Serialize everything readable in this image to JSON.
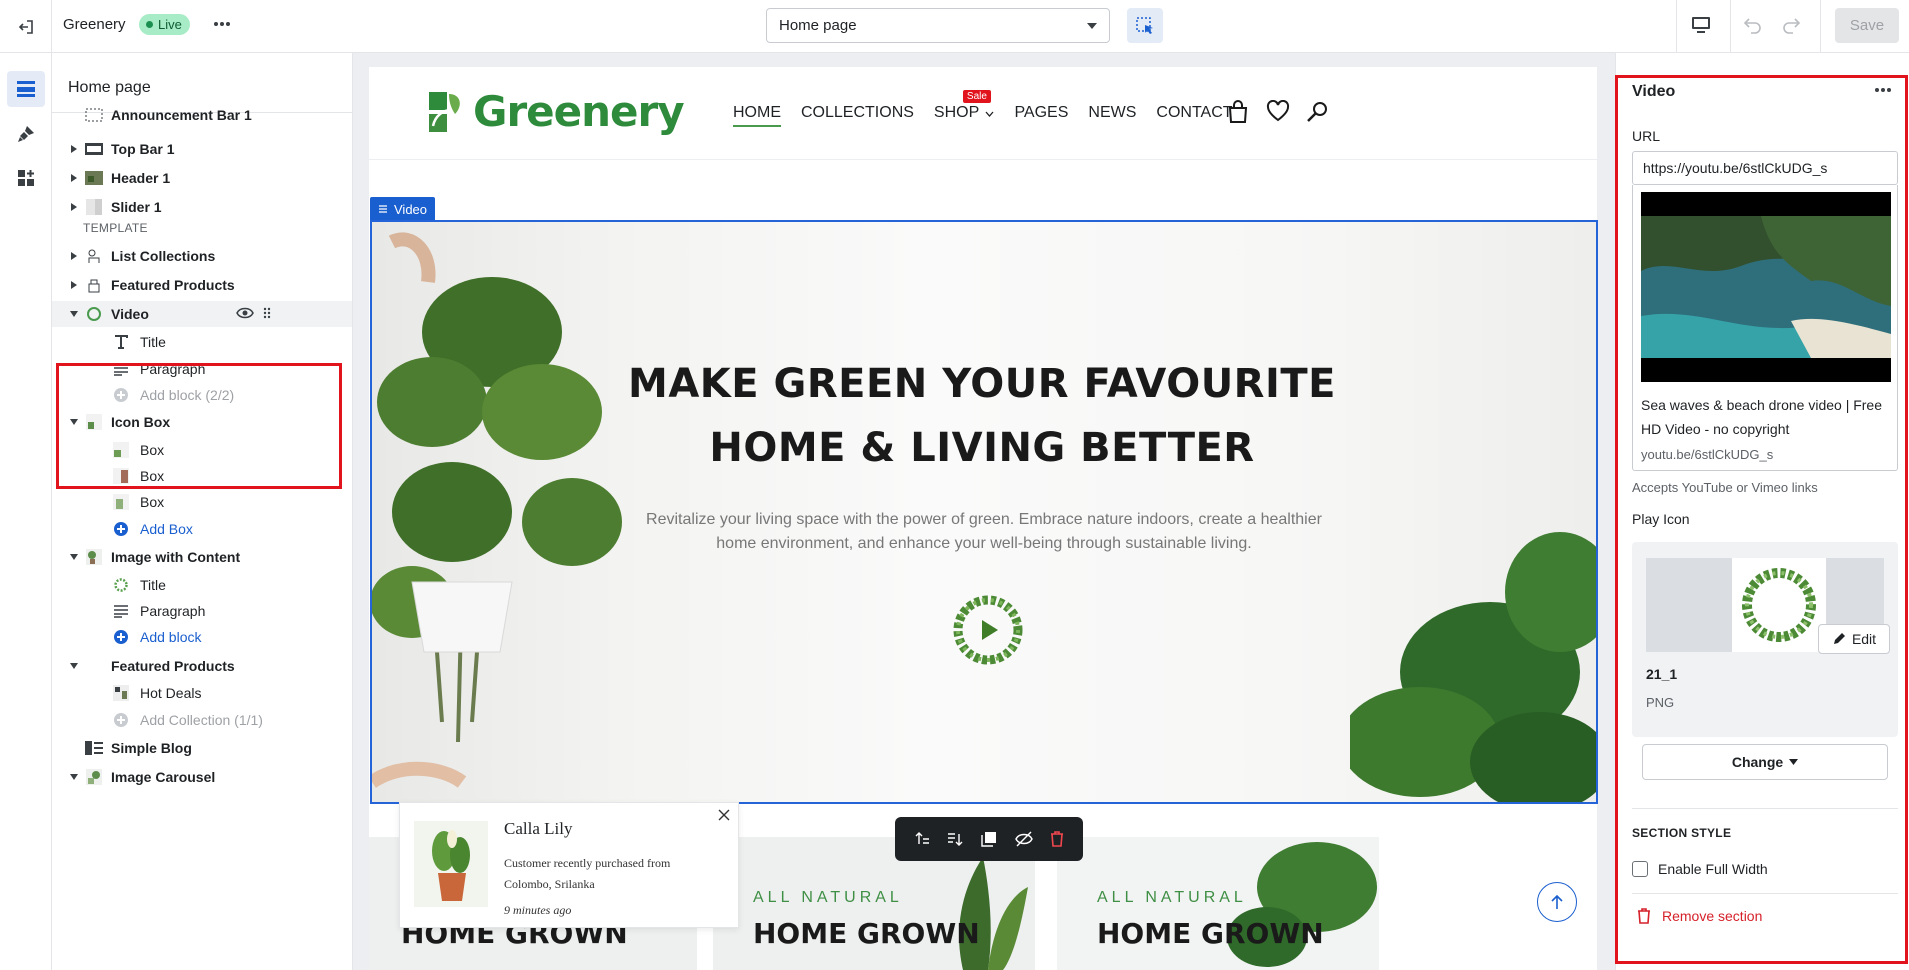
{
  "topbar": {
    "app_name": "Greenery",
    "status": "Live",
    "page_select": "Home page",
    "save_label": "Save"
  },
  "layers": {
    "title": "Home page",
    "partial_item": "Announcement Bar 1",
    "header_items": [
      "Top Bar 1",
      "Header 1",
      "Slider 1"
    ],
    "template_label": "TEMPLATE",
    "sections": {
      "list_collections": "List Collections",
      "featured_products": "Featured Products",
      "video": "Video",
      "video_blocks": [
        "Title",
        "Paragraph"
      ],
      "video_add_block": "Add block (2/2)",
      "icon_box": "Icon Box",
      "icon_box_blocks": [
        "Box",
        "Box",
        "Box"
      ],
      "icon_box_add": "Add Box",
      "image_with_content": "Image with Content",
      "iwc_blocks": [
        "Title",
        "Paragraph"
      ],
      "iwc_add": "Add block",
      "featured_products_2": "Featured Products",
      "fp2_blocks": [
        "Hot Deals"
      ],
      "fp2_add": "Add Collection (1/1)",
      "simple_blog": "Simple Blog",
      "image_carousel": "Image Carousel"
    }
  },
  "site": {
    "logo": "Greenery",
    "nav": [
      "HOME",
      "COLLECTIONS",
      "SHOP",
      "PAGES",
      "NEWS",
      "CONTACT"
    ],
    "sale_badge": "Sale",
    "video_tag": "Video",
    "hero_title_1": "MAKE GREEN YOUR FAVOURITE",
    "hero_title_2": "HOME & LIVING BETTER",
    "hero_paragraph_1": "Revitalize your living space with the power of green. Embrace nature indoors, create a healthier",
    "hero_paragraph_2": "home environment, and enhance your well-being through sustainable living.",
    "cards": [
      {
        "eyebrow": "",
        "title": "HOME GROWN"
      },
      {
        "eyebrow": "ALL NATURAL",
        "title": "HOME GROWN"
      },
      {
        "eyebrow": "ALL NATURAL",
        "title": "HOME GROWN"
      }
    ],
    "popup": {
      "product": "Calla Lily",
      "desc_1": "Customer recently purchased  from",
      "desc_2": "Colombo, Srilanka",
      "time": "9 minutes ago"
    }
  },
  "settings": {
    "title": "Video",
    "url_label": "URL",
    "url_value": "https://youtu.be/6stlCkUDG_s",
    "video_title_1": "Sea waves & beach drone video | Free",
    "video_title_2": "HD Video - no copyright",
    "video_link": "youtu.be/6stlCkUDG_s",
    "hint": "Accepts YouTube or Vimeo links",
    "play_icon_label": "Play Icon",
    "edit_label": "Edit",
    "file_name": "21_1",
    "file_type": "PNG",
    "change_label": "Change",
    "section_style": "SECTION STYLE",
    "full_width_label": "Enable Full Width",
    "remove_label": "Remove section"
  },
  "colors": {
    "accent_blue": "#1a5fcf",
    "highlight_red": "#e1141d",
    "brand_green": "#2e8b3c",
    "live_badge": "#a7ecc6"
  }
}
